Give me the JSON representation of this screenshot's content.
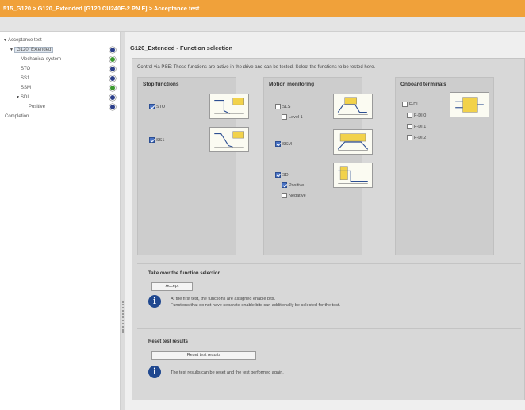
{
  "window": {
    "title": "515_G120 > G120_Extended [G120 CU240E-2 PN F] > Acceptance test"
  },
  "sidebar": {
    "root": "Acceptance test",
    "items": [
      {
        "label": "G120_Extended",
        "status": "blue"
      },
      {
        "label": "Mechanical system",
        "status": "green"
      },
      {
        "label": "STO",
        "status": "blue"
      },
      {
        "label": "SS1",
        "status": "blue"
      },
      {
        "label": "SSM",
        "status": "green"
      },
      {
        "label": "SDI",
        "status": "blue"
      },
      {
        "label": "Positive",
        "status": "blue"
      },
      {
        "label": "Completion",
        "status": ""
      }
    ],
    "status_colors": {
      "blue": "#2c3f8a",
      "green": "#3c9a2e"
    }
  },
  "main": {
    "heading": "G120_Extended - Function selection",
    "intro": "Control via PSE: These functions are active in the drive and can be tested. Select the functions to be tested here.",
    "groups": {
      "stop": {
        "title": "Stop functions",
        "items": [
          {
            "label": "STO",
            "checked": true
          },
          {
            "label": "SS1",
            "checked": true
          }
        ],
        "pictos": [
          "sto-diagram-icon",
          "ss1-diagram-icon"
        ]
      },
      "motion": {
        "title": "Motion monitoring",
        "items": [
          {
            "label": "SLS",
            "checked": false
          },
          {
            "label": "Level 1",
            "checked": false
          },
          {
            "label": "SSM",
            "checked": true
          },
          {
            "label": "SDI",
            "checked": true
          },
          {
            "label": "Positive",
            "checked": true
          },
          {
            "label": "Negative",
            "checked": false
          }
        ],
        "pictos": [
          "sls-diagram-icon",
          "ssm-diagram-icon",
          "sdi-diagram-icon"
        ]
      },
      "onboard": {
        "title": "Onboard terminals",
        "items": [
          {
            "label": "F-DI",
            "checked": false
          },
          {
            "label": "F-DI 0",
            "checked": false
          },
          {
            "label": "F-DI 1",
            "checked": false
          },
          {
            "label": "F-DI 2",
            "checked": false
          }
        ],
        "pictos": [
          "fdi-terminal-icon"
        ]
      }
    },
    "take_over": {
      "title": "Take over the function selection",
      "button": "Accept",
      "info_line1": "At the first test, the functions are assigned enable bits.",
      "info_line2": "Functions that do not have separate enable bits can additionally be selected for the test."
    },
    "reset": {
      "title": "Reset test results",
      "button": "Reset test results",
      "info": "The test results can be reset and the test performed again."
    }
  }
}
